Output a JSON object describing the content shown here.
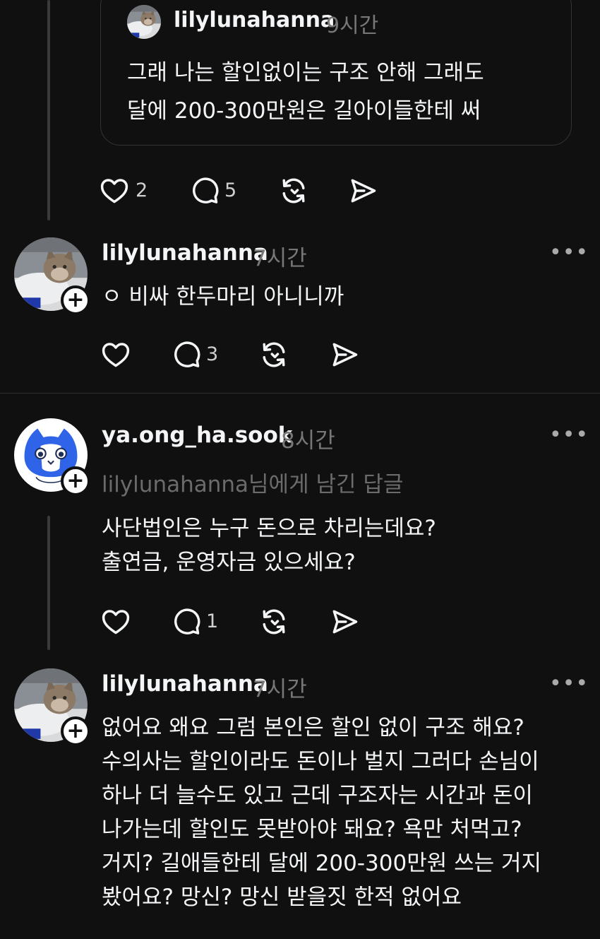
{
  "quoted_post": {
    "username": "lilylunahanna",
    "time": "9시간",
    "text": "그래 나는 할인없이는 구조 안해 그래도\n달에 200-300만원은 길아이들한테 써",
    "likes": "2",
    "replies": "5"
  },
  "posts": [
    {
      "username": "lilylunahanna",
      "time": "7시간",
      "text": "ㅇ 비싸 한두마리 아니니까",
      "likes": "",
      "replies": "3"
    },
    {
      "username": "ya.ong_ha.sook",
      "time": "8시간",
      "reply_to": "lilylunahanna님에게 남긴 답글",
      "text": "사단법인은 누구 돈으로 차리는데요?\n출연금, 운영자금 있으세요?",
      "likes": "",
      "replies": "1"
    },
    {
      "username": "lilylunahanna",
      "time": "7시간",
      "text": "없어요 왜요  그럼 본인은 할인 없이 구조 해요?\n수의사는 할인이라도 돈이나 벌지 그러다 손님이\n하나 더 늘수도 있고 근데 구조자는 시간과 돈이\n나가는데 할인도 못받아야 돼요? 욕만 처먹고?\n거지?  길애들한테 달에 200-300만원 쓰는 거지\n봤어요? 망신? 망신 받을짓 한적 없어요"
    }
  ],
  "icons": {
    "like": "heart-icon",
    "reply": "comment-icon",
    "repost": "repost-icon",
    "share": "send-icon",
    "more": "more-dots-icon",
    "follow": "follow-plus-icon"
  },
  "labels": {
    "more": "•••",
    "plus": "+"
  }
}
